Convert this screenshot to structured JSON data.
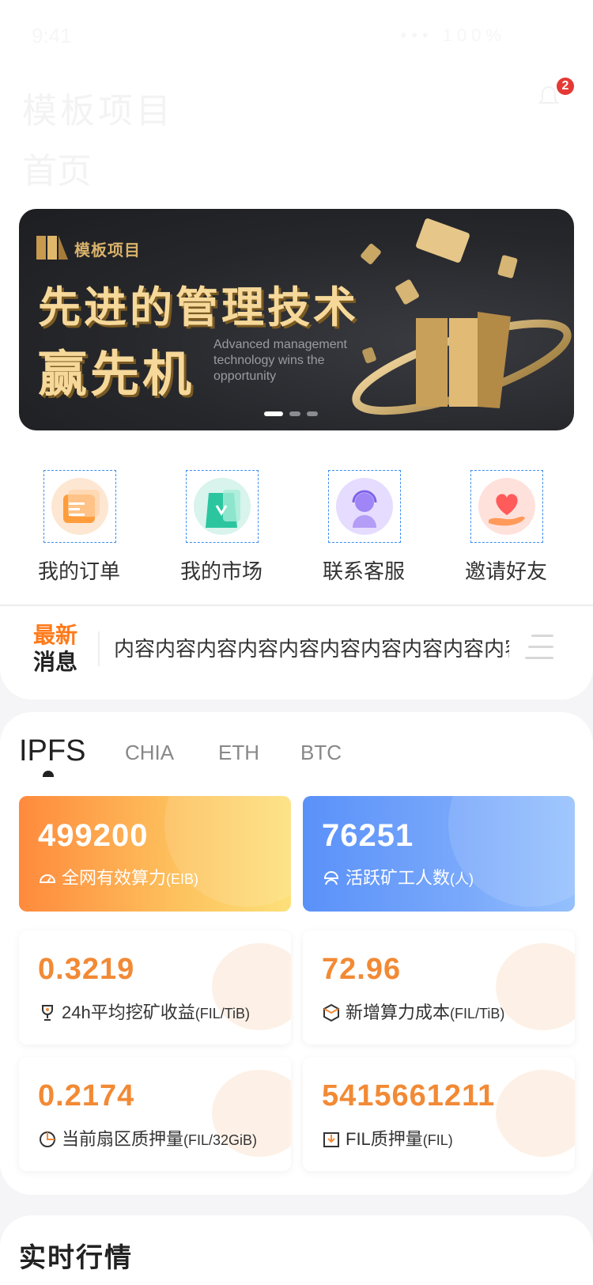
{
  "status_bar": {
    "time": "9:41",
    "icons": "••• 100%"
  },
  "header": {
    "title": "模板项目",
    "subtitle": "首页",
    "notification_count": "2"
  },
  "banner": {
    "brand": "模板项目",
    "headline_line1": "先进的管理技术",
    "headline_line2": "赢先机",
    "english": "Advanced management technology wins the opportunity",
    "slides": 3,
    "active_slide": 1
  },
  "quick_menu": [
    {
      "label": "我的订单",
      "icon": "order-icon"
    },
    {
      "label": "我的市场",
      "icon": "market-icon"
    },
    {
      "label": "联系客服",
      "icon": "customer-service-icon"
    },
    {
      "label": "邀请好友",
      "icon": "invite-heart-icon"
    }
  ],
  "news": {
    "tag_line1": "最新",
    "tag_line2": "消息",
    "text": "内容内容内容内容内容内容内容内容内容内容"
  },
  "tabs": [
    "IPFS",
    "CHIA",
    "ETH",
    "BTC"
  ],
  "active_tab": "IPFS",
  "stats": {
    "network_power": {
      "value": "499200",
      "label": "全网有效算力",
      "unit": "(EIB)"
    },
    "active_miners": {
      "value": "76251",
      "label": "活跃矿工人数",
      "unit": "(人)"
    },
    "avg_reward": {
      "value": "0.3219",
      "label": "24h平均挖矿收益",
      "unit": "(FIL/TiB)"
    },
    "new_power_cost": {
      "value": "72.96",
      "label": "新增算力成本",
      "unit": "(FIL/TiB)"
    },
    "sector_pledge": {
      "value": "0.2174",
      "label": "当前扇区质押量",
      "unit": "(FIL/32GiB)"
    },
    "fil_pledge": {
      "value": "5415661211",
      "label": "FIL质押量",
      "unit": "(FIL)"
    }
  },
  "market": {
    "title": "实时行情"
  },
  "colors": {
    "accent_orange": "#f28a35",
    "accent_blue": "#5a91f9",
    "banner_gold": "#f6d99a"
  }
}
